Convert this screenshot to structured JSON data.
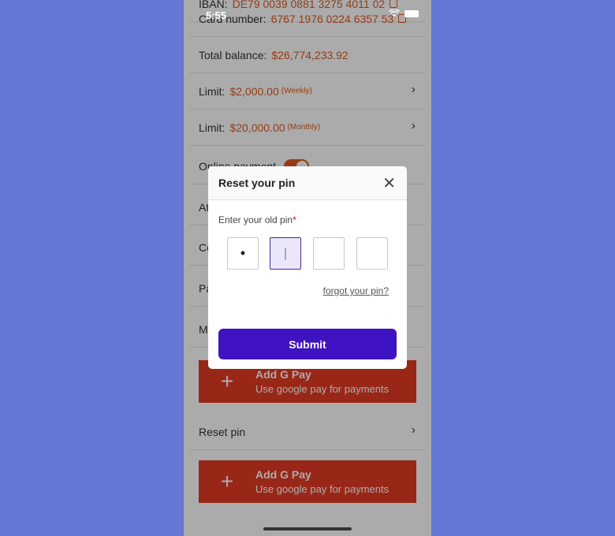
{
  "status": {
    "time": "5:55"
  },
  "account": {
    "iban_label": "IBAN:",
    "iban_value": "DE79 0039 0881 3275 4011 02",
    "card_label": "Card number:",
    "card_value": "6767 1976 0224 6357 53",
    "balance_label": "Total balance:",
    "balance_value": "$26,774,233.92",
    "limit_label": "Limit:",
    "weekly_value": "$2,000.00",
    "weekly_sub": "(Weekly)",
    "monthly_value": "$20,000.00",
    "monthly_sub": "(Monthly)",
    "online_payment_label": "Online payment",
    "hidden_row_1": "At",
    "hidden_row_2": "Co",
    "hidden_row_3": "Pa",
    "hidden_row_4": "Ma",
    "reset_pin_label": "Reset pin",
    "online_payment_enabled": true
  },
  "gpay": {
    "title": "Add G Pay",
    "description": "Use google pay for payments"
  },
  "modal": {
    "title": "Reset your pin",
    "pin_label": "Enter your old pin",
    "required_mark": "*",
    "pin_digits": [
      "•",
      "|",
      "",
      ""
    ],
    "forgot_link": "forgot your pin?",
    "submit_label": "Submit"
  },
  "colors": {
    "background": "#6577d5",
    "accent": "#e05a1e",
    "gpay_red": "#e53b25",
    "submit_purple": "#3f13c2"
  }
}
